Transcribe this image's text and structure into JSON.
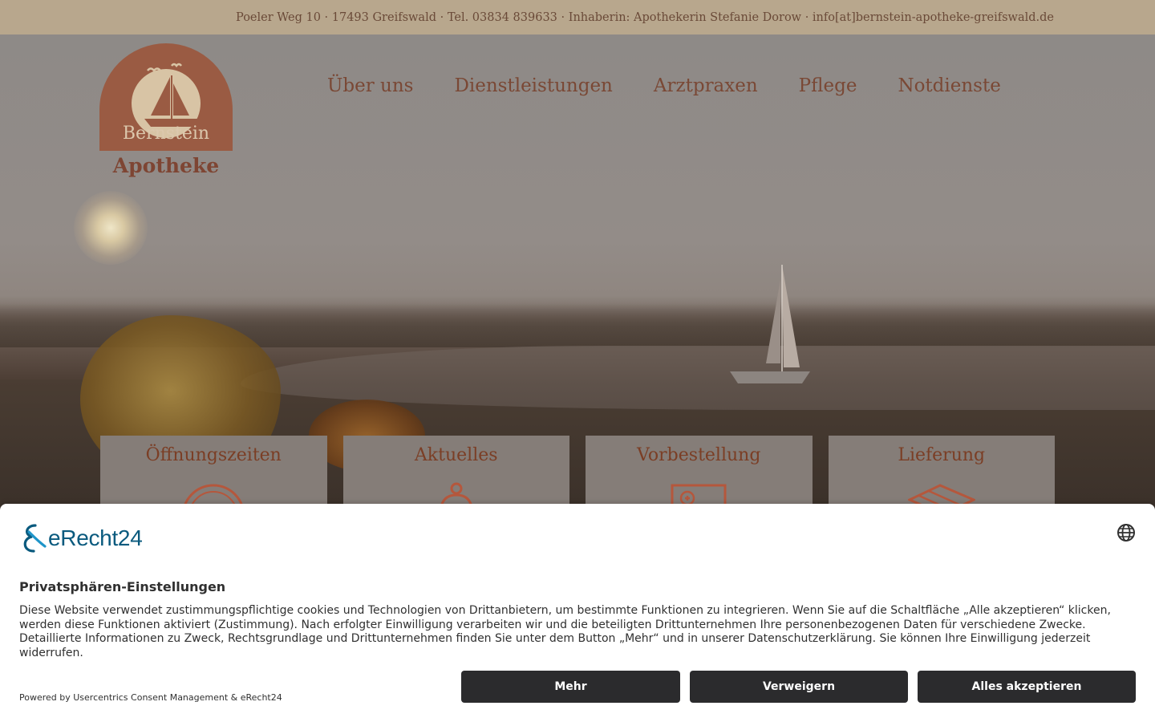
{
  "topbar": {
    "info": "Poeler Weg 10 · 17493 Greifswald · Tel. 03834 839633 · Inhaberin: Apothekerin Stefanie Dorow · info[at]bernstein-apotheke-greifswald.de"
  },
  "logo": {
    "line1": "Bernstein",
    "line2": "Apotheke"
  },
  "nav": {
    "items": [
      {
        "label": "Über uns"
      },
      {
        "label": "Dienstleistungen"
      },
      {
        "label": "Arztpraxen"
      },
      {
        "label": "Pflege"
      },
      {
        "label": "Notdienste"
      }
    ]
  },
  "cards": [
    {
      "title": "Öffnungszeiten",
      "icon": "clock-icon"
    },
    {
      "title": "Aktuelles",
      "icon": "bell-icon"
    },
    {
      "title": "Vorbestellung",
      "icon": "prescription-icon"
    },
    {
      "title": "Lieferung",
      "icon": "package-icon"
    }
  ],
  "consent": {
    "brand": "eRecht24",
    "heading": "Privatsphären-Einstellungen",
    "body": "Diese Website verwendet zustimmungspflichtige cookies und Technologien von Drittanbietern, um bestimmte Funktionen zu integrieren. Wenn Sie auf die Schaltfläche „Alle akzeptieren“ klicken, werden diese Funktionen aktiviert (Zustimmung). Nach erfolgter Einwilligung verarbeiten wir und die beteiligten Drittunternehmen Ihre personenbezogenen Daten für verschiedene Zwecke. Detaillierte Informationen zu Zweck, Rechtsgrundlage und Drittunternehmen finden Sie unter dem Button „Mehr“ und in unserer Datenschutzerklärung. Sie können Ihre Einwilligung jederzeit widerrufen.",
    "powered_by": "Powered by Usercentrics Consent Management & eRecht24",
    "buttons": {
      "more": "Mehr",
      "deny": "Verweigern",
      "accept_all": "Alles akzeptieren"
    },
    "language_icon": "globe-icon"
  },
  "colors": {
    "topbar_bg": "#b8a78d",
    "brand_brown": "#7a4835",
    "button_dark": "#2b2b2d",
    "erecht_blue": "#0a5a7e"
  }
}
